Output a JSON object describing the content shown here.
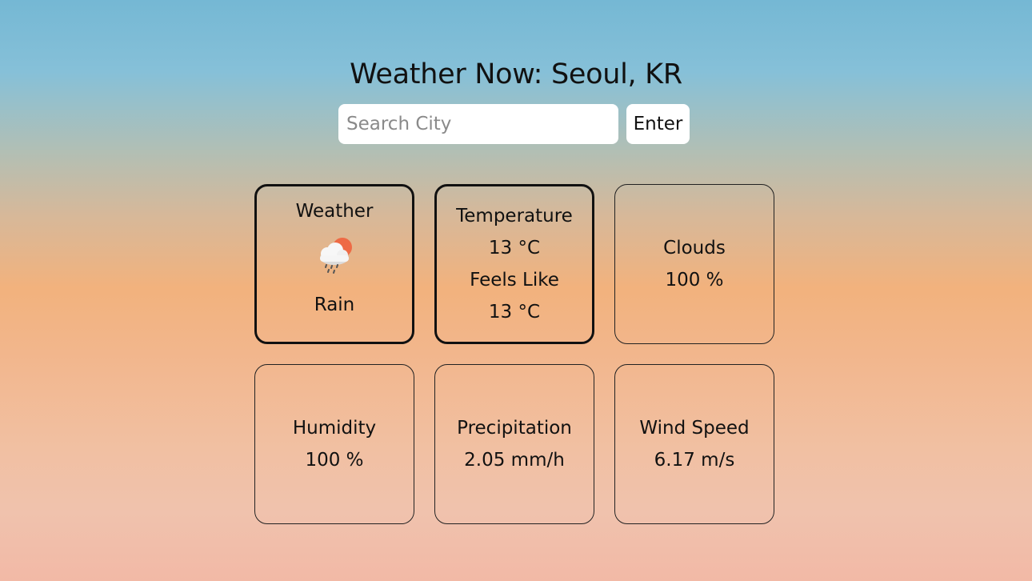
{
  "header": {
    "title": "Weather Now: Seoul, KR"
  },
  "search": {
    "placeholder": "Search City",
    "value": "",
    "button_label": "Enter"
  },
  "cards": {
    "weather": {
      "label": "Weather",
      "icon": "rain-cloud-sun-icon",
      "condition": "Rain"
    },
    "temperature": {
      "label": "Temperature",
      "value": "13 °C",
      "feels_like_label": "Feels Like",
      "feels_like_value": "13 °C"
    },
    "clouds": {
      "label": "Clouds",
      "value": "100 %"
    },
    "humidity": {
      "label": "Humidity",
      "value": "100 %"
    },
    "precipitation": {
      "label": "Precipitation",
      "value": "2.05 mm/h"
    },
    "wind_speed": {
      "label": "Wind Speed",
      "value": "6.17 m/s"
    }
  },
  "colors": {
    "sky_top": "#75b8d4",
    "sky_middle": "#f2b27d",
    "sky_bottom": "#f2b9a6",
    "sun": "#ee6a45",
    "cloud": "#f5f5f5"
  }
}
